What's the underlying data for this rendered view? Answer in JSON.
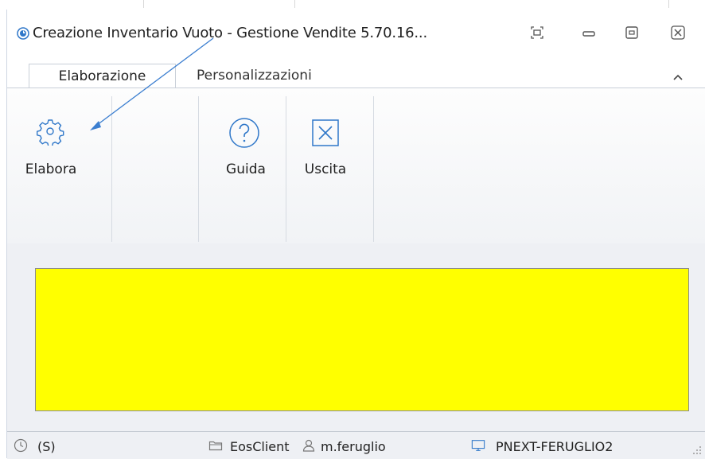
{
  "window": {
    "title": "Creazione Inventario Vuoto - Gestione Vendite 5.70.16..."
  },
  "titlebar_buttons": [
    {
      "name": "restore-layout-icon"
    },
    {
      "name": "minimize-icon"
    },
    {
      "name": "maximize-icon"
    },
    {
      "name": "close-icon"
    }
  ],
  "tabs": [
    {
      "label": "Elaborazione",
      "active": true
    },
    {
      "label": "Personalizzazioni",
      "active": false
    }
  ],
  "ribbon": {
    "elabora_label": "Elabora",
    "guida_label": "Guida",
    "uscita_label": "Uscita"
  },
  "statusbar": {
    "shortcut": "(S)",
    "server": "EosClient",
    "user": "m.feruglio",
    "machine": "PNEXT-FERUGLIO2"
  },
  "colors": {
    "highlight_panel": "#ffff00",
    "accent": "#2f77c9",
    "annotation_arrow": "#3c7fd0"
  }
}
